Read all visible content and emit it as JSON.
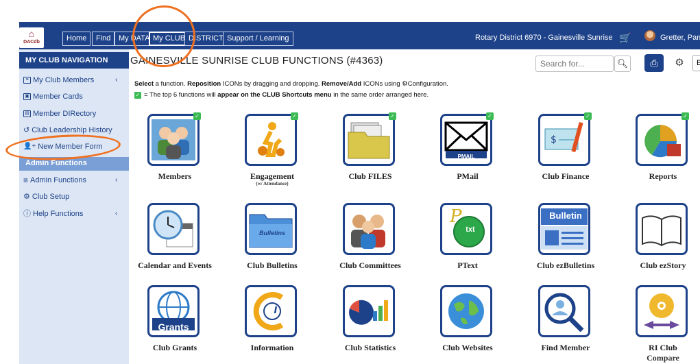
{
  "topbar": {
    "logo_text": "DACdb",
    "tabs": [
      "Home",
      "Find",
      "My DATA",
      "My CLUB",
      "DISTRICT",
      "Support / Learning"
    ],
    "active_tab": "My CLUB",
    "district_label": "Rotary District 6970 - Gainesville Sunrise",
    "user_name": "Gretter, Pam",
    "accent_color": "#1d4289"
  },
  "sidebar": {
    "header": "MY CLUB NAVIGATION",
    "items": [
      {
        "label": "My Club Members",
        "icon": "members-list-icon",
        "chevron": "‹"
      },
      {
        "label": "Member Cards",
        "icon": "card-icon"
      },
      {
        "label": "Member DIRectory",
        "icon": "directory-icon"
      },
      {
        "label": "Club Leadership History",
        "icon": "history-icon"
      },
      {
        "label": "New Member Form",
        "icon": "add-user-icon"
      }
    ],
    "admin_header": "Admin Functions",
    "admin_items": [
      {
        "label": "Admin Functions",
        "icon": "menu-icon",
        "chevron": "‹"
      },
      {
        "label": "Club Setup",
        "icon": "settings-icon"
      },
      {
        "label": "Help Functions",
        "icon": "help-icon",
        "chevron": "‹"
      }
    ]
  },
  "main": {
    "title": "GAINESVILLE SUNRISE CLUB FUNCTIONS (#4363)",
    "search_placeholder": "Search for...",
    "instruction_1_a": "Select",
    "instruction_1_b": " a function. ",
    "instruction_1_c": "Reposition",
    "instruction_1_d": " ICONs by dragging and dropping. ",
    "instruction_1_e": "Remove/Add",
    "instruction_1_f": " ICONs using ",
    "instruction_1_g": "Configuration.",
    "instruction_2_a": "= The top 6 functions will ",
    "instruction_2_b": "appear on the CLUB Shortcuts menu",
    "instruction_2_c": " in the same order arranged here."
  },
  "tiles": [
    {
      "label": "Members",
      "icon": "members-icon",
      "shortcut": true
    },
    {
      "label": "Engagement",
      "sub": "(w/ Attendance)",
      "icon": "engagement-icon",
      "shortcut": true
    },
    {
      "label": "Club FILES",
      "icon": "folder-icon",
      "shortcut": true
    },
    {
      "label": "PMail",
      "icon": "envelope-icon",
      "icon_text": "PMAIL",
      "shortcut": true
    },
    {
      "label": "Club Finance",
      "icon": "check-pen-icon",
      "shortcut": true
    },
    {
      "label": "Reports",
      "icon": "pie-chart-icon",
      "shortcut": true
    },
    {
      "label": "Calendar and Events",
      "icon": "calendar-clock-icon"
    },
    {
      "label": "Club Bulletins",
      "icon": "bulletins-folder-icon",
      "icon_text": "Bulletins"
    },
    {
      "label": "Club Committees",
      "icon": "committee-icon"
    },
    {
      "label": "PText",
      "icon": "text-bubble-icon",
      "icon_text": "txt"
    },
    {
      "label": "Club ezBulletins",
      "icon": "ezbulletin-icon",
      "icon_text": "Bulletin"
    },
    {
      "label": "Club ezStory",
      "icon": "open-book-icon"
    },
    {
      "label": "Club Grants",
      "icon": "globe-grants-icon",
      "icon_text": "Grants"
    },
    {
      "label": "Information",
      "icon": "info-icon",
      "icon_text": "i"
    },
    {
      "label": "Club Statistics",
      "icon": "stats-icon"
    },
    {
      "label": "Club Websites",
      "icon": "globe-icon"
    },
    {
      "label": "Find Member",
      "icon": "find-member-icon"
    },
    {
      "label": "RI Club",
      "sub": "Compare",
      "icon": "rotary-compare-icon"
    }
  ]
}
